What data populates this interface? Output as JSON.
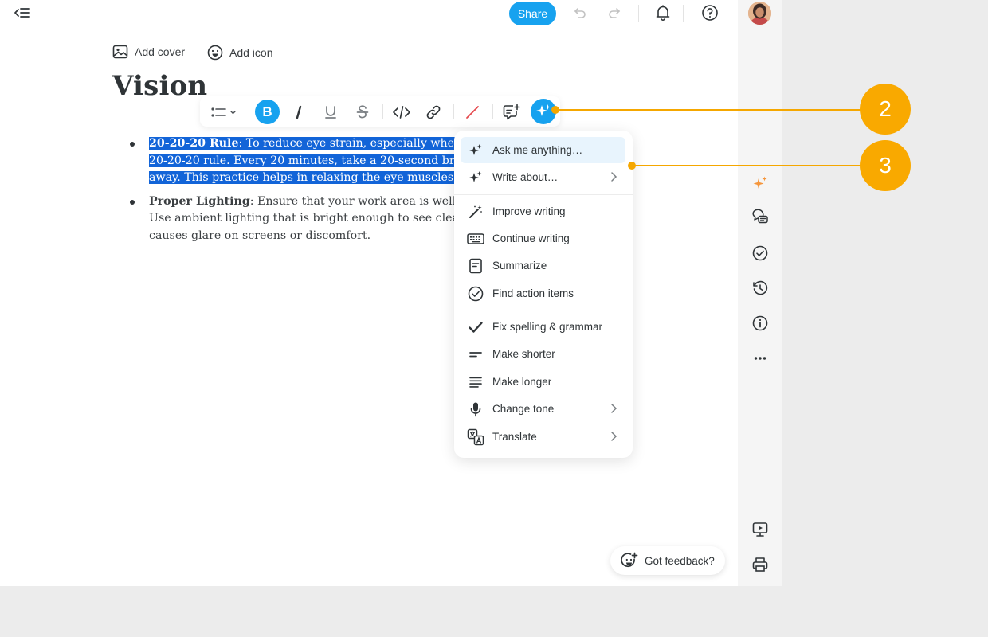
{
  "topbar": {
    "share_label": "Share"
  },
  "doc": {
    "add_cover": "Add cover",
    "add_icon": "Add icon",
    "title": "Vision",
    "bullets": [
      {
        "bold": "20-20-20 Rule",
        "lines": [
          ": To reduce eye strain, especially when wo",
          "20-20-20 rule. Every 20 minutes, take a 20-second breal",
          "away. This practice helps in relaxing the eye muscles and"
        ]
      },
      {
        "bold": "Proper Lighting",
        "lines": [
          ": Ensure that your work area is well-lit to",
          "Use ambient lighting that is bright enough to see clearly",
          "causes glare on screens or discomfort."
        ]
      }
    ]
  },
  "ai_menu": {
    "items": [
      {
        "label": "Ask me anything…",
        "icon": "sparkle-icon"
      },
      {
        "label": "Write about…",
        "icon": "sparkle-icon"
      },
      {
        "label": "Improve writing",
        "icon": "magic-wand-icon"
      },
      {
        "label": "Continue writing",
        "icon": "keyboard-icon"
      },
      {
        "label": "Summarize",
        "icon": "document-icon"
      },
      {
        "label": "Find action items",
        "icon": "check-circle-icon"
      },
      {
        "label": "Fix spelling & grammar",
        "icon": "checkmark-icon"
      },
      {
        "label": "Make shorter",
        "icon": "short-lines-icon"
      },
      {
        "label": "Make longer",
        "icon": "long-lines-icon"
      },
      {
        "label": "Change tone",
        "icon": "microphone-icon"
      },
      {
        "label": "Translate",
        "icon": "translate-icon"
      }
    ]
  },
  "feedback": {
    "label": "Got feedback?"
  },
  "callouts": [
    "2",
    "3"
  ],
  "colors": {
    "accent": "#17a2ef",
    "selection": "#1264d8",
    "callout": "#f9a900"
  }
}
